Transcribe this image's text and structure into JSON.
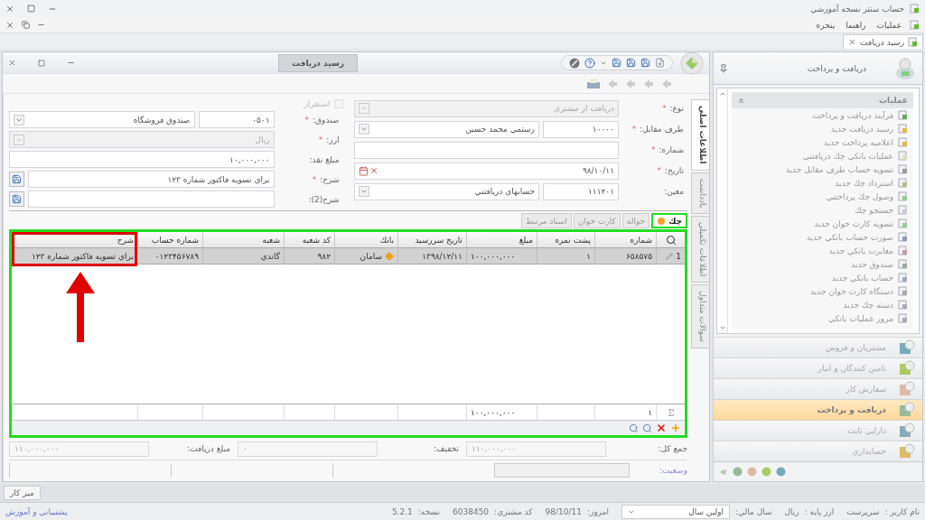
{
  "app": {
    "title": "حساب ستتر نسخه آموزشي",
    "menus": [
      "عمليات",
      "راهنما",
      "پنجره"
    ]
  },
  "doc_tabs": [
    {
      "label": "رسيد دريافت",
      "selected": true
    }
  ],
  "window": {
    "title": "رسيد دريافت"
  },
  "vertical_tabs": [
    {
      "label": "اطلاعات اصلي",
      "selected": true
    },
    {
      "label": "يادداشت",
      "selected": false
    },
    {
      "label": "اطلاعات تكميلي",
      "selected": false
    },
    {
      "label": "سوالات متداول",
      "selected": false
    }
  ],
  "form": {
    "right": [
      {
        "kind": "dropdown",
        "label": "نوع:",
        "mark": "*",
        "value": "دريافت از مشتري",
        "disabled": true
      },
      {
        "kind": "code_dropdown",
        "label": "طرف مقابل:",
        "mark": "*",
        "code": "۱۰۰۰۰",
        "value": "رستمي محمد حسين",
        "disabled": false
      },
      {
        "kind": "text",
        "label": "شماره:",
        "mark": "*",
        "disabled": false
      },
      {
        "kind": "date",
        "label": "تاريخ:",
        "mark": "*",
        "value": "۹۸/۱۰/۱۱",
        "disabled": false
      },
      {
        "kind": "code_dropdown",
        "label": "معين:",
        "code": "۱۱۱۲۰۱",
        "value": "حسابهاي دريافتني",
        "disabled": false
      }
    ],
    "checkbox": {
      "label": "استقرار",
      "checked": false,
      "disabled": true
    },
    "left": [
      {
        "kind": "code_dropdown",
        "label": "صندوق:",
        "mark": "*",
        "code": "۰۵۰۱",
        "value": "صندوق فروشگاه",
        "disabled": false
      },
      {
        "kind": "dropdown",
        "label": "ارز:",
        "mark": "*",
        "value": "ريال",
        "disabled": true
      },
      {
        "kind": "text",
        "label": "مبلغ نقد:",
        "value": "۱۰,۰۰۰,۰۰۰",
        "disabled": false
      },
      {
        "kind": "text_save",
        "label": "شرح:",
        "mark": "*",
        "value": "براي تسويه فاكتور شماره  ۱۲۳",
        "disabled": false
      },
      {
        "kind": "text_save",
        "label": "شرح(2):",
        "disabled": false
      }
    ]
  },
  "sub_tabs": [
    {
      "label": "چك",
      "selected": true
    },
    {
      "label": "حواله",
      "selected": false
    },
    {
      "label": "كارت خوان",
      "selected": false
    },
    {
      "label": "اسناد مرتبط",
      "selected": false
    }
  ],
  "grid": {
    "columns": [
      "شماره",
      "پشت نمره",
      "مبلغ",
      "تاريخ سررسيد",
      "بانك",
      "كد شعبه",
      "شعبه",
      "شماره حساب",
      "شرح"
    ],
    "rows": [
      {
        "index": "1",
        "selected": true,
        "cells": [
          "۶۵۸۵۷۵",
          "۱",
          "۱۰۰,۰۰۰,۰۰۰",
          "۱۳۹۸/۱۲/۱۱",
          "سامان",
          "۹۸۲",
          "گاندي",
          "۰۱۲۳۴۵۶۷۸۹",
          "براي تسويه فاكتور شماره  ۱۲۳"
        ]
      }
    ],
    "footer": {
      "count": "۱",
      "total": "۱۰۰,۰۰۰,۰۰۰"
    }
  },
  "totals": [
    {
      "label": "جمع كل:",
      "value": "۱۱۰,۰۰۰,۰۰۰"
    },
    {
      "label": "تخفيف:",
      "value": "۰"
    },
    {
      "label": "مبلغ دريافت:",
      "value": "۱۱۰,۰۰۰,۰۰۰"
    }
  ],
  "status": {
    "label": "وضعيت:"
  },
  "desk_button": "ميز كار",
  "sidebar": {
    "header": "دريافت و پرداخت",
    "group": {
      "title": "عمليات",
      "expanded": true,
      "items": [
        "فرآيند دريافت و پرداخت",
        "رسيد دريافت جديد",
        "اعلاميه پرداخت جديد",
        "عمليات بانكي چك دريافتني",
        "تسويه حساب طرف مقابل جديد",
        "استرداد چك جديد",
        "وصول چك پرداختني",
        "جستجو چك",
        "تسويه كارت خوان جديد",
        "صورت حساب بانكي جديد",
        "مغايرت بانكي جديد",
        "صندوق جديد",
        "حساب بانكي جديد",
        "دستگاه كارت خوان جديد",
        "دسته چك جديد",
        "مرور عمليات بانكي"
      ]
    },
    "nav": [
      {
        "label": "مشتريان و فروش",
        "selected": false
      },
      {
        "label": "تامين كنندگان و انبار",
        "selected": false
      },
      {
        "label": "سفارش كار",
        "selected": false
      },
      {
        "label": "دريافت و پرداخت",
        "selected": true
      },
      {
        "label": "دارايي ثابت",
        "selected": false
      },
      {
        "label": "حسابداري",
        "selected": false
      }
    ]
  },
  "status_bar": {
    "items": [
      {
        "label": "نام كاربر :",
        "value": "سرپرست"
      },
      {
        "label": "ارز پايه :",
        "value": "ريال"
      },
      {
        "label": "سال مالي:",
        "value": "اولين سال",
        "kind": "dropdown"
      },
      {
        "label": "امروز:",
        "value": "98/10/11"
      },
      {
        "label": "كد مشتري:",
        "value": "6038450"
      },
      {
        "label": "نسخه:",
        "value": "5.2.1"
      }
    ],
    "link": "پشتيباني و آموزش"
  }
}
